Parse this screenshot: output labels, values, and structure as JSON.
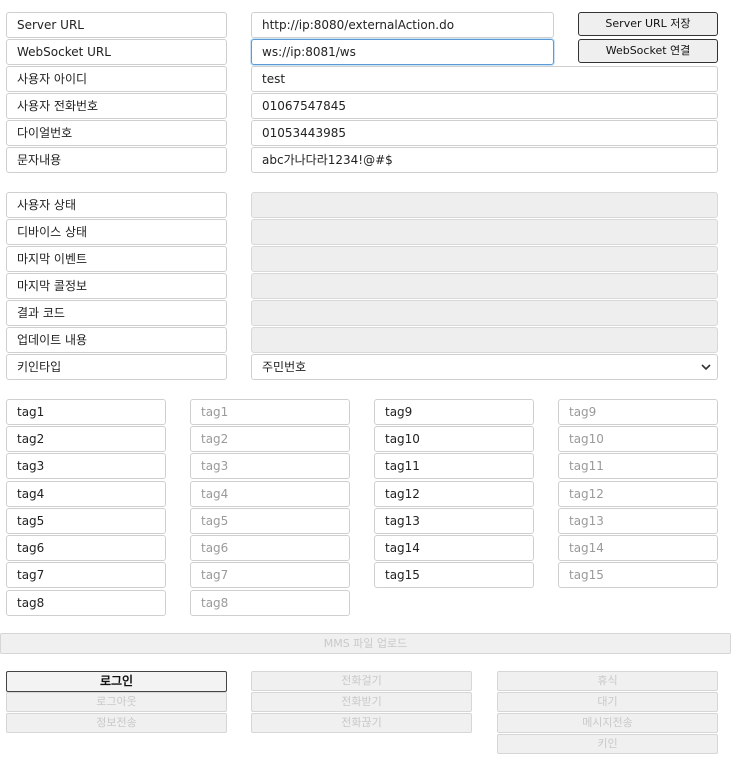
{
  "config": {
    "server_url_label": "Server URL",
    "server_url_value": "http://ip:8080/externalAction.do",
    "ws_url_label": "WebSocket URL",
    "ws_url_value": "ws://ip:8081/ws",
    "user_id_label": "사용자 아이디",
    "user_id_value": "test",
    "user_phone_label": "사용자 전화번호",
    "user_phone_value": "01067547845",
    "dial_label": "다이얼번호",
    "dial_value": "01053443985",
    "sms_label": "문자내용",
    "sms_value": "abc가나다라1234!@#$",
    "save_server_btn": "Server URL 저장",
    "connect_ws_btn": "WebSocket 연결"
  },
  "status": {
    "user_state_label": "사용자 상태",
    "device_state_label": "디바이스 상태",
    "last_event_label": "마지막 이벤트",
    "last_call_label": "마지막 콜정보",
    "result_code_label": "결과 코드",
    "update_label": "업데이트 내용",
    "key_type_label": "키인타입",
    "key_type_value": "주민번호"
  },
  "tags": [
    {
      "label": "tag1",
      "placeholder": "tag1"
    },
    {
      "label": "tag2",
      "placeholder": "tag2"
    },
    {
      "label": "tag3",
      "placeholder": "tag3"
    },
    {
      "label": "tag4",
      "placeholder": "tag4"
    },
    {
      "label": "tag5",
      "placeholder": "tag5"
    },
    {
      "label": "tag6",
      "placeholder": "tag6"
    },
    {
      "label": "tag7",
      "placeholder": "tag7"
    },
    {
      "label": "tag8",
      "placeholder": "tag8"
    },
    {
      "label": "tag9",
      "placeholder": "tag9"
    },
    {
      "label": "tag10",
      "placeholder": "tag10"
    },
    {
      "label": "tag11",
      "placeholder": "tag11"
    },
    {
      "label": "tag12",
      "placeholder": "tag12"
    },
    {
      "label": "tag13",
      "placeholder": "tag13"
    },
    {
      "label": "tag14",
      "placeholder": "tag14"
    },
    {
      "label": "tag15",
      "placeholder": "tag15"
    }
  ],
  "actions": {
    "mms_upload": "MMS 파일 업로드",
    "login": "로그인",
    "logout": "로그아웃",
    "info_send": "정보전송",
    "make_call": "전화걸기",
    "answer_call": "전화받기",
    "hangup": "전화끊기",
    "rest": "휴식",
    "wait": "대기",
    "message_send": "메시지전송",
    "key_in": "키인"
  }
}
